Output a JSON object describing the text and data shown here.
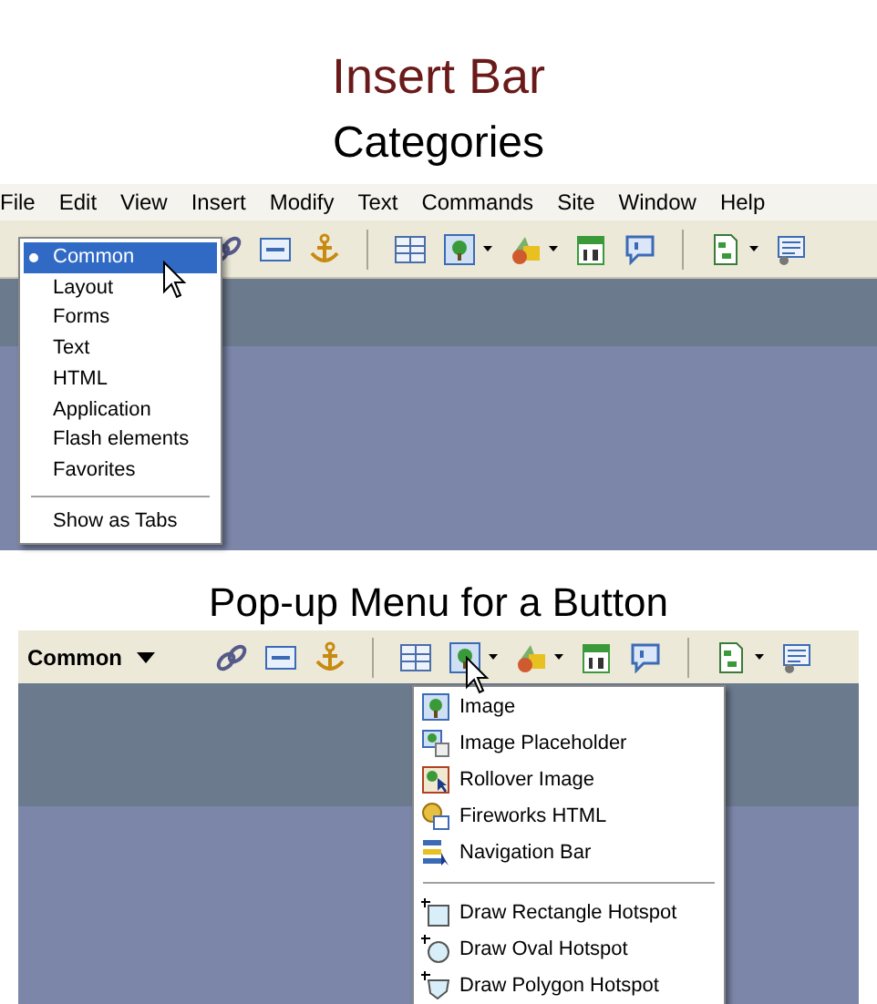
{
  "title": "Insert Bar",
  "categories": {
    "heading": "Categories",
    "menubar": [
      "File",
      "Edit",
      "View",
      "Insert",
      "Modify",
      "Text",
      "Commands",
      "Site",
      "Window",
      "Help"
    ],
    "menu_items": [
      {
        "label": "Common",
        "selected": true
      },
      {
        "label": "Layout",
        "selected": false
      },
      {
        "label": "Forms",
        "selected": false
      },
      {
        "label": "Text",
        "selected": false
      },
      {
        "label": "HTML",
        "selected": false
      },
      {
        "label": "Application",
        "selected": false
      },
      {
        "label": "Flash elements",
        "selected": false
      },
      {
        "label": "Favorites",
        "selected": false
      }
    ],
    "menu_footer": "Show as Tabs"
  },
  "popup": {
    "heading": "Pop-up Menu for a Button",
    "category": "Common",
    "groups": [
      [
        "Image",
        "Image Placeholder",
        "Rollover Image",
        "Fireworks HTML",
        "Navigation Bar"
      ],
      [
        "Draw Rectangle Hotspot",
        "Draw Oval Hotspot",
        "Draw Polygon Hotspot"
      ]
    ]
  }
}
